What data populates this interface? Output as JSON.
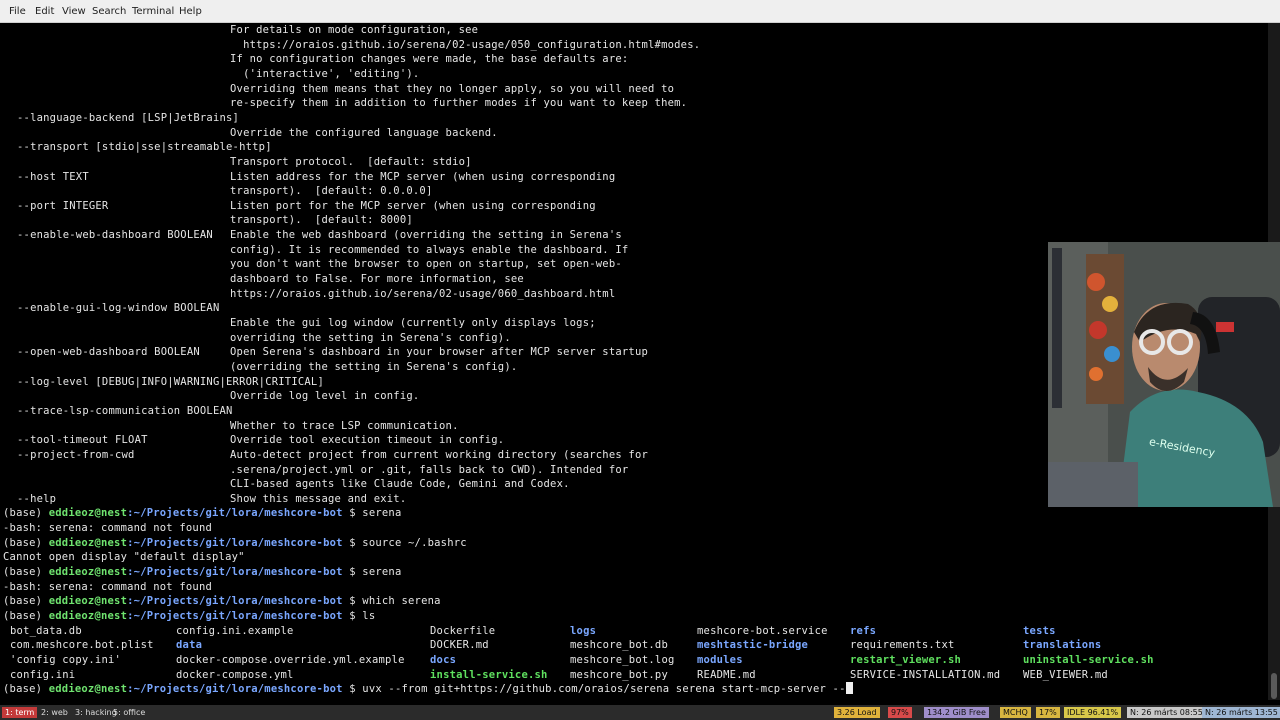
{
  "menubar": {
    "items": [
      "File",
      "Edit",
      "View",
      "Search",
      "Terminal",
      "Help"
    ]
  },
  "help_output": [
    {
      "opt": "",
      "desc": "For details on mode configuration, see"
    },
    {
      "opt": "",
      "desc": "  https://oraios.github.io/serena/02-usage/050_configuration.html#modes."
    },
    {
      "opt": "",
      "desc": "If no configuration changes were made, the base defaults are:"
    },
    {
      "opt": "",
      "desc": "  ('interactive', 'editing')."
    },
    {
      "opt": "",
      "desc": "Overriding them means that they no longer apply, so you will need to"
    },
    {
      "opt": "",
      "desc": "re-specify them in addition to further modes if you want to keep them."
    },
    {
      "opt": "--language-backend [LSP|JetBrains]",
      "desc": ""
    },
    {
      "opt": "",
      "desc": "Override the configured language backend."
    },
    {
      "opt": "--transport [stdio|sse|streamable-http]",
      "desc": ""
    },
    {
      "opt": "",
      "desc": "Transport protocol.  [default: stdio]"
    },
    {
      "opt": "--host TEXT",
      "desc": "Listen address for the MCP server (when using corresponding"
    },
    {
      "opt": "",
      "desc": "transport).  [default: 0.0.0.0]"
    },
    {
      "opt": "--port INTEGER",
      "desc": "Listen port for the MCP server (when using corresponding"
    },
    {
      "opt": "",
      "desc": "transport).  [default: 8000]"
    },
    {
      "opt": "--enable-web-dashboard BOOLEAN",
      "desc": "Enable the web dashboard (overriding the setting in Serena's"
    },
    {
      "opt": "",
      "desc": "config). It is recommended to always enable the dashboard. If"
    },
    {
      "opt": "",
      "desc": "you don't want the browser to open on startup, set open-web-"
    },
    {
      "opt": "",
      "desc": "dashboard to False. For more information, see"
    },
    {
      "opt": "",
      "desc": "https://oraios.github.io/serena/02-usage/060_dashboard.html"
    },
    {
      "opt": "--enable-gui-log-window BOOLEAN",
      "desc": ""
    },
    {
      "opt": "",
      "desc": "Enable the gui log window (currently only displays logs;"
    },
    {
      "opt": "",
      "desc": "overriding the setting in Serena's config)."
    },
    {
      "opt": "--open-web-dashboard BOOLEAN",
      "desc": "Open Serena's dashboard in your browser after MCP server startup"
    },
    {
      "opt": "",
      "desc": "(overriding the setting in Serena's config)."
    },
    {
      "opt": "--log-level [DEBUG|INFO|WARNING|ERROR|CRITICAL]",
      "desc": ""
    },
    {
      "opt": "",
      "desc": "Override log level in config."
    },
    {
      "opt": "--trace-lsp-communication BOOLEAN",
      "desc": ""
    },
    {
      "opt": "",
      "desc": "Whether to trace LSP communication."
    },
    {
      "opt": "--tool-timeout FLOAT",
      "desc": "Override tool execution timeout in config."
    },
    {
      "opt": "--project-from-cwd",
      "desc": "Auto-detect project from current working directory (searches for"
    },
    {
      "opt": "",
      "desc": ".serena/project.yml or .git, falls back to CWD). Intended for"
    },
    {
      "opt": "",
      "desc": "CLI-based agents like Claude Code, Gemini and Codex."
    },
    {
      "opt": "--help",
      "desc": "Show this message and exit."
    }
  ],
  "prompt": {
    "env": "(base) ",
    "user": "eddieoz@nest",
    "path": ":~/Projects/git/lora/meshcore-bot",
    "symbol": " $ "
  },
  "session": [
    {
      "kind": "cmd",
      "text": "serena"
    },
    {
      "kind": "out",
      "text": "-bash: serena: command not found"
    },
    {
      "kind": "cmd",
      "text": "source ~/.bashrc"
    },
    {
      "kind": "out",
      "text": "Cannot open display \"default display\""
    },
    {
      "kind": "cmd",
      "text": "serena"
    },
    {
      "kind": "out",
      "text": "-bash: serena: command not found"
    },
    {
      "kind": "cmd",
      "text": "which serena"
    },
    {
      "kind": "cmd",
      "text": "ls"
    }
  ],
  "ls_columns": [
    [
      {
        "name": "bot_data.db",
        "type": "file"
      },
      {
        "name": "com.meshcore.bot.plist",
        "type": "file"
      },
      {
        "name": "'config copy.ini'",
        "type": "file"
      },
      {
        "name": "config.ini",
        "type": "file"
      }
    ],
    [
      {
        "name": "config.ini.example",
        "type": "file"
      },
      {
        "name": "data",
        "type": "dir"
      },
      {
        "name": "docker-compose.override.yml.example",
        "type": "file"
      },
      {
        "name": "docker-compose.yml",
        "type": "file"
      }
    ],
    [
      {
        "name": "Dockerfile",
        "type": "file"
      },
      {
        "name": "DOCKER.md",
        "type": "file"
      },
      {
        "name": "docs",
        "type": "dir"
      },
      {
        "name": "install-service.sh",
        "type": "exec"
      }
    ],
    [
      {
        "name": "logs",
        "type": "dir"
      },
      {
        "name": "meshcore_bot.db",
        "type": "file"
      },
      {
        "name": "meshcore_bot.log",
        "type": "file"
      },
      {
        "name": "meshcore_bot.py",
        "type": "file"
      }
    ],
    [
      {
        "name": "meshcore-bot.service",
        "type": "file"
      },
      {
        "name": "meshtastic-bridge",
        "type": "dir"
      },
      {
        "name": "modules",
        "type": "dir"
      },
      {
        "name": "README.md",
        "type": "file"
      }
    ],
    [
      {
        "name": "refs",
        "type": "dir"
      },
      {
        "name": "requirements.txt",
        "type": "file"
      },
      {
        "name": "restart_viewer.sh",
        "type": "exec"
      },
      {
        "name": "SERVICE-INSTALLATION.md",
        "type": "file"
      }
    ],
    [
      {
        "name": "tests",
        "type": "dir"
      },
      {
        "name": "translations",
        "type": "dir"
      },
      {
        "name": "uninstall-service.sh",
        "type": "exec"
      },
      {
        "name": "WEB_VIEWER.md",
        "type": "file"
      }
    ]
  ],
  "current_command": "uvx --from git+https://github.com/oraios/serena serena start-mcp-server --",
  "colors": {
    "user": "#6fe36f",
    "path": "#7aa7ff",
    "dir": "#7aa7ff",
    "exec": "#5fe05f",
    "text": "#e6e6e6",
    "background": "#000000",
    "active_workspace": "#c43a3a"
  },
  "taskbar": {
    "workspaces": [
      "1: term",
      "2: web",
      "3: hacking",
      "5: office"
    ],
    "active_workspace": "1: term",
    "tray": [
      {
        "text": "3.26 Load",
        "bg": "#e0b23b"
      },
      {
        "text": "97%",
        "bg": "#d84a4a"
      },
      {
        "text": "134.2 GiB Free",
        "bg": "#9f8ecb"
      },
      {
        "text": "MCHQ",
        "bg": "#d8b640"
      },
      {
        "text": "17%",
        "bg": "#d8b640"
      },
      {
        "text": "IDLE 96.41%",
        "bg": "#d8c84a"
      },
      {
        "text": "N: 26 márts 08:55",
        "bg": "#c9c9c9"
      },
      {
        "text": "N: 26 márts 13:55",
        "bg": "#9fb7d4"
      }
    ]
  },
  "webcam": {
    "shirt_text": "e-Residency"
  }
}
